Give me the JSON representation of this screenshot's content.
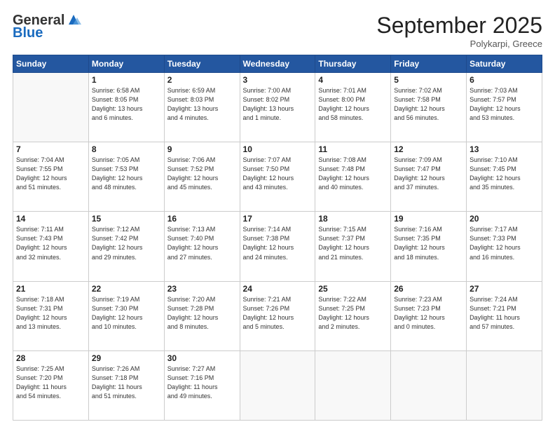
{
  "logo": {
    "general": "General",
    "blue": "Blue"
  },
  "title": "September 2025",
  "subtitle": "Polykarpi, Greece",
  "days_header": [
    "Sunday",
    "Monday",
    "Tuesday",
    "Wednesday",
    "Thursday",
    "Friday",
    "Saturday"
  ],
  "weeks": [
    [
      {
        "day": "",
        "info": ""
      },
      {
        "day": "1",
        "info": "Sunrise: 6:58 AM\nSunset: 8:05 PM\nDaylight: 13 hours\nand 6 minutes."
      },
      {
        "day": "2",
        "info": "Sunrise: 6:59 AM\nSunset: 8:03 PM\nDaylight: 13 hours\nand 4 minutes."
      },
      {
        "day": "3",
        "info": "Sunrise: 7:00 AM\nSunset: 8:02 PM\nDaylight: 13 hours\nand 1 minute."
      },
      {
        "day": "4",
        "info": "Sunrise: 7:01 AM\nSunset: 8:00 PM\nDaylight: 12 hours\nand 58 minutes."
      },
      {
        "day": "5",
        "info": "Sunrise: 7:02 AM\nSunset: 7:58 PM\nDaylight: 12 hours\nand 56 minutes."
      },
      {
        "day": "6",
        "info": "Sunrise: 7:03 AM\nSunset: 7:57 PM\nDaylight: 12 hours\nand 53 minutes."
      }
    ],
    [
      {
        "day": "7",
        "info": "Sunrise: 7:04 AM\nSunset: 7:55 PM\nDaylight: 12 hours\nand 51 minutes."
      },
      {
        "day": "8",
        "info": "Sunrise: 7:05 AM\nSunset: 7:53 PM\nDaylight: 12 hours\nand 48 minutes."
      },
      {
        "day": "9",
        "info": "Sunrise: 7:06 AM\nSunset: 7:52 PM\nDaylight: 12 hours\nand 45 minutes."
      },
      {
        "day": "10",
        "info": "Sunrise: 7:07 AM\nSunset: 7:50 PM\nDaylight: 12 hours\nand 43 minutes."
      },
      {
        "day": "11",
        "info": "Sunrise: 7:08 AM\nSunset: 7:48 PM\nDaylight: 12 hours\nand 40 minutes."
      },
      {
        "day": "12",
        "info": "Sunrise: 7:09 AM\nSunset: 7:47 PM\nDaylight: 12 hours\nand 37 minutes."
      },
      {
        "day": "13",
        "info": "Sunrise: 7:10 AM\nSunset: 7:45 PM\nDaylight: 12 hours\nand 35 minutes."
      }
    ],
    [
      {
        "day": "14",
        "info": "Sunrise: 7:11 AM\nSunset: 7:43 PM\nDaylight: 12 hours\nand 32 minutes."
      },
      {
        "day": "15",
        "info": "Sunrise: 7:12 AM\nSunset: 7:42 PM\nDaylight: 12 hours\nand 29 minutes."
      },
      {
        "day": "16",
        "info": "Sunrise: 7:13 AM\nSunset: 7:40 PM\nDaylight: 12 hours\nand 27 minutes."
      },
      {
        "day": "17",
        "info": "Sunrise: 7:14 AM\nSunset: 7:38 PM\nDaylight: 12 hours\nand 24 minutes."
      },
      {
        "day": "18",
        "info": "Sunrise: 7:15 AM\nSunset: 7:37 PM\nDaylight: 12 hours\nand 21 minutes."
      },
      {
        "day": "19",
        "info": "Sunrise: 7:16 AM\nSunset: 7:35 PM\nDaylight: 12 hours\nand 18 minutes."
      },
      {
        "day": "20",
        "info": "Sunrise: 7:17 AM\nSunset: 7:33 PM\nDaylight: 12 hours\nand 16 minutes."
      }
    ],
    [
      {
        "day": "21",
        "info": "Sunrise: 7:18 AM\nSunset: 7:31 PM\nDaylight: 12 hours\nand 13 minutes."
      },
      {
        "day": "22",
        "info": "Sunrise: 7:19 AM\nSunset: 7:30 PM\nDaylight: 12 hours\nand 10 minutes."
      },
      {
        "day": "23",
        "info": "Sunrise: 7:20 AM\nSunset: 7:28 PM\nDaylight: 12 hours\nand 8 minutes."
      },
      {
        "day": "24",
        "info": "Sunrise: 7:21 AM\nSunset: 7:26 PM\nDaylight: 12 hours\nand 5 minutes."
      },
      {
        "day": "25",
        "info": "Sunrise: 7:22 AM\nSunset: 7:25 PM\nDaylight: 12 hours\nand 2 minutes."
      },
      {
        "day": "26",
        "info": "Sunrise: 7:23 AM\nSunset: 7:23 PM\nDaylight: 12 hours\nand 0 minutes."
      },
      {
        "day": "27",
        "info": "Sunrise: 7:24 AM\nSunset: 7:21 PM\nDaylight: 11 hours\nand 57 minutes."
      }
    ],
    [
      {
        "day": "28",
        "info": "Sunrise: 7:25 AM\nSunset: 7:20 PM\nDaylight: 11 hours\nand 54 minutes."
      },
      {
        "day": "29",
        "info": "Sunrise: 7:26 AM\nSunset: 7:18 PM\nDaylight: 11 hours\nand 51 minutes."
      },
      {
        "day": "30",
        "info": "Sunrise: 7:27 AM\nSunset: 7:16 PM\nDaylight: 11 hours\nand 49 minutes."
      },
      {
        "day": "",
        "info": ""
      },
      {
        "day": "",
        "info": ""
      },
      {
        "day": "",
        "info": ""
      },
      {
        "day": "",
        "info": ""
      }
    ]
  ]
}
